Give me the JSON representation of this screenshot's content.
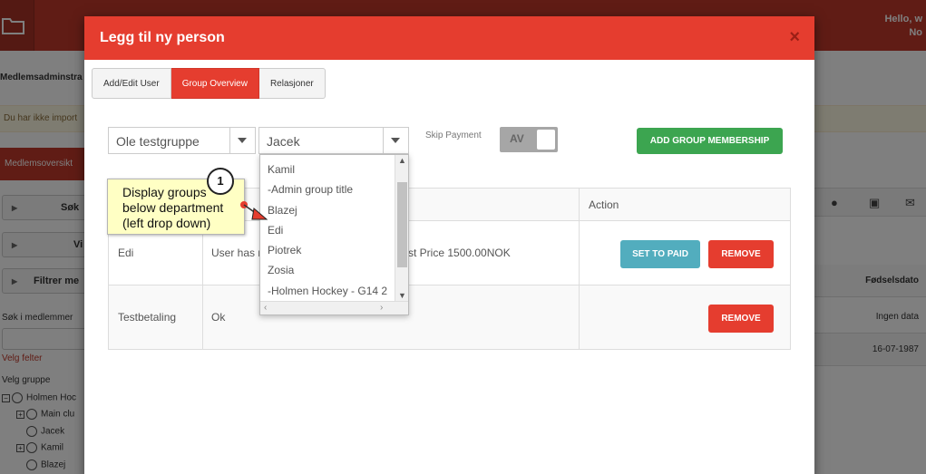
{
  "background": {
    "hello_line1": "Hello, w",
    "hello_line2": "No",
    "page_title": "Medlemsadminstra",
    "warning": "Du har ikke import",
    "red_tab": "Medlemsoversikt",
    "side_buttons": [
      "Søk",
      "Vi",
      "Filtrer me"
    ],
    "search_label": "Søk i medlemmer",
    "velg_felter": "Velg felter",
    "velg_gruppe": "Velg gruppe",
    "tree": [
      "Holmen Hoc",
      "Main clu",
      "Jacek",
      "Kamil",
      "Blazej"
    ],
    "right_header_label": "Fødselsdato",
    "right_rows": [
      "Ingen data",
      "16-07-1987"
    ]
  },
  "modal": {
    "title": "Legg til ny person",
    "close_icon": "×",
    "tabs": [
      {
        "label": "Add/Edit User",
        "active": false
      },
      {
        "label": "Group Overview",
        "active": true
      },
      {
        "label": "Relasjoner",
        "active": false
      }
    ],
    "department_select": "Ole testgruppe",
    "group_select": "Jacek",
    "skip_payment_label": "Skip Payment",
    "toggle_text": "AV",
    "add_membership_button": "ADD GROUP MEMBERSHIP",
    "table": {
      "headers": [
        "",
        "ipti",
        "Action"
      ],
      "rows": [
        {
          "group": "Edi",
          "description": "User has n",
          "description_tail": "st Price 1500.00NOK",
          "buttons": [
            "SET TO PAID",
            "REMOVE"
          ]
        },
        {
          "group": "Testbetaling",
          "description": "Ok",
          "description_tail": "",
          "buttons": [
            "REMOVE"
          ]
        }
      ]
    },
    "dropdown_items": [
      "Kamil",
      "-Admin group title",
      "Blazej",
      "Edi",
      "Piotrek",
      "Zosia",
      "-Holmen Hockey - G14 2"
    ]
  },
  "callout": {
    "step": "1",
    "text_line1": "Display groups",
    "text_line2": "below department",
    "text_line3": "(left drop down)"
  },
  "colors": {
    "header_red": "#e53d2f",
    "green": "#3ca550",
    "teal": "#52adbe",
    "callout_yellow": "#ffffc4"
  }
}
